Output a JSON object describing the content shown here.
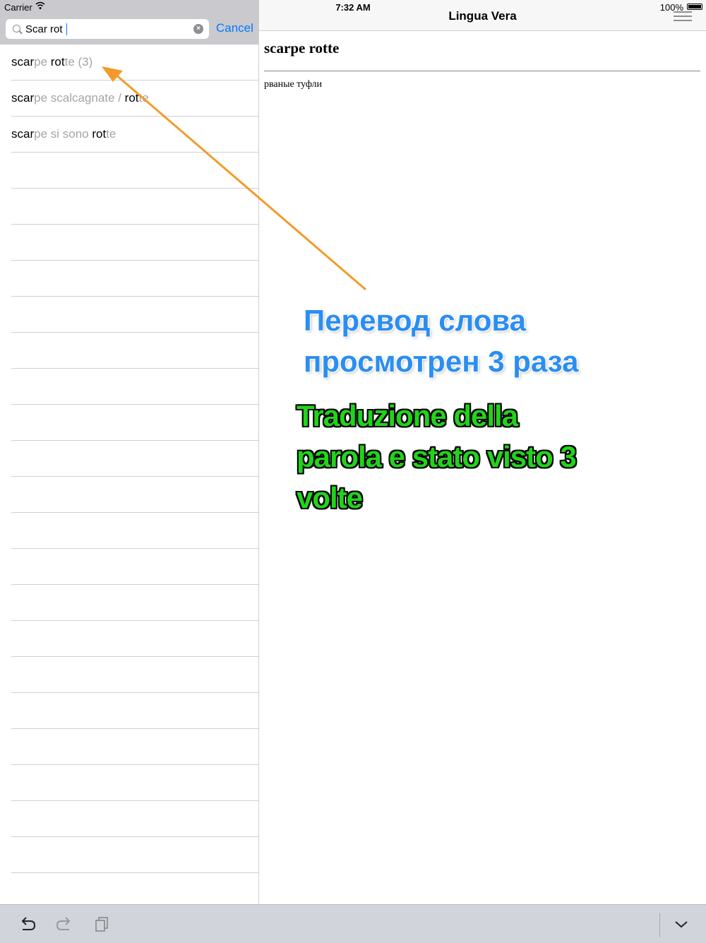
{
  "status": {
    "carrier": "Carrier",
    "time": "7:32 AM",
    "battery": "100%"
  },
  "search": {
    "value": "Scar rot",
    "cancel_label": "Cancel"
  },
  "results": [
    {
      "m1": "scar",
      "d1": "pe ",
      "m2": "rot",
      "d2": "te (3)"
    },
    {
      "m1": "scar",
      "d1": "pe scalcagnate / ",
      "m2": "rot",
      "d2": "te"
    },
    {
      "m1": "scar",
      "d1": "pe si sono ",
      "m2": "rot",
      "d2": "te"
    }
  ],
  "nav": {
    "title": "Lingua Vera"
  },
  "entry": {
    "title": "scarpe rotte",
    "translation": "рваные туфли"
  },
  "annotations": {
    "ru_line1": "Перевод слова",
    "ru_line2": "просмотрен 3 раза",
    "it_line1": "Traduzione della",
    "it_line2": "parola e stato visto 3",
    "it_line3": "volte"
  },
  "icons": {
    "toolbar": [
      "undo-icon",
      "redo-icon",
      "copy-icon",
      "chevron-down-icon"
    ]
  },
  "colors": {
    "accent": "#007aff",
    "arrow": "#f39a2b",
    "annotation_ru": "#2b8ef0",
    "annotation_it": "#22d31b"
  }
}
